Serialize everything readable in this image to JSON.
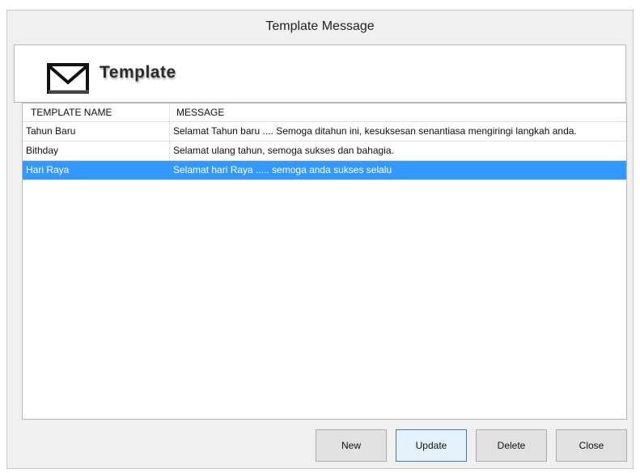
{
  "window": {
    "title": "Template Message"
  },
  "header": {
    "title": "Template",
    "icon": "envelope-icon"
  },
  "list": {
    "columns": [
      "TEMPLATE NAME",
      "MESSAGE"
    ],
    "rows": [
      {
        "name": "Tahun Baru",
        "message": "Selamat Tahun baru .... Semoga ditahun ini, kesuksesan senantiasa mengiringi langkah anda."
      },
      {
        "name": "Bithday",
        "message": "Selamat ulang tahun, semoga sukses dan bahagia."
      },
      {
        "name": "Hari Raya",
        "message": "Selamat hari Raya ..... semoga anda sukses selalu"
      }
    ],
    "selected_row": 2,
    "selection_color": "#3399ff"
  },
  "buttons": {
    "new_label": "New",
    "update_label": "Update",
    "delete_label": "Delete",
    "close_label": "Close"
  }
}
